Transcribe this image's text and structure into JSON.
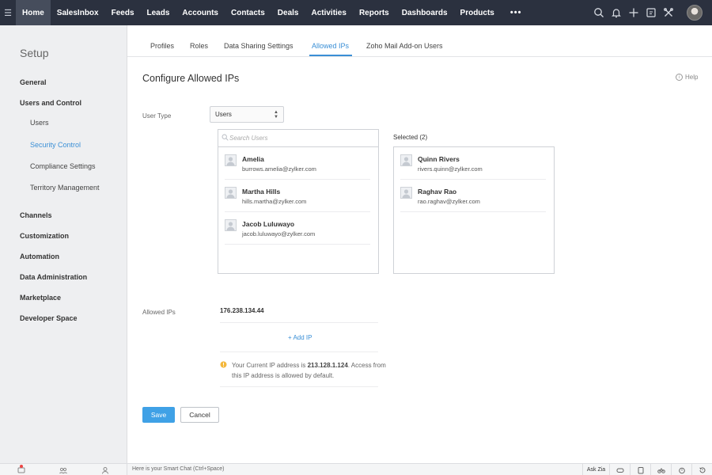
{
  "topnav": {
    "items": [
      "Home",
      "SalesInbox",
      "Feeds",
      "Leads",
      "Accounts",
      "Contacts",
      "Deals",
      "Activities",
      "Reports",
      "Dashboards",
      "Products"
    ],
    "more": "•••",
    "icons": [
      "search-icon",
      "bell-icon",
      "plus-icon",
      "calendar-icon",
      "tools-icon",
      "avatar"
    ]
  },
  "sidebar": {
    "title": "Setup",
    "sections": [
      "General",
      "Users and Control",
      "Channels",
      "Customization",
      "Automation",
      "Data Administration",
      "Marketplace",
      "Developer Space"
    ],
    "sub_items": [
      "Users",
      "Security Control",
      "Compliance Settings",
      "Territory Management"
    ],
    "active_sub": "Security Control"
  },
  "tabs": [
    "Profiles",
    "Roles",
    "Data Sharing Settings",
    "Allowed IPs",
    "Zoho Mail Add-on Users"
  ],
  "active_tab": "Allowed IPs",
  "page": {
    "title": "Configure Allowed IPs",
    "help": "Help"
  },
  "form": {
    "user_type_label": "User Type",
    "user_type_value": "Users",
    "search_placeholder": "Search Users",
    "selected_label": "Selected (2)",
    "available_users": [
      {
        "name": "Amelia",
        "email": "burrows.amelia@zylker.com"
      },
      {
        "name": "Martha Hills",
        "email": "hills.martha@zylker.com"
      },
      {
        "name": "Jacob Luluwayo",
        "email": "jacob.luluwayo@zylker.com"
      }
    ],
    "selected_users": [
      {
        "name": "Quinn Rivers",
        "email": "rivers.quinn@zylker.com"
      },
      {
        "name": "Raghav Rao",
        "email": "rao.raghav@zylker.com"
      }
    ],
    "allowed_ips_label": "Allowed IPs",
    "allowed_ip": "176.238.134.44",
    "add_ip": "+ Add IP",
    "info_prefix": "Your Current IP address is ",
    "current_ip": "213.128.1.124",
    "info_suffix": ". Access from this IP address is allowed by default.",
    "save": "Save",
    "cancel": "Cancel"
  },
  "bottombar": {
    "chat_placeholder": "Here is your Smart Chat (Ctrl+Space)",
    "ask_zia": "Ask Zia"
  },
  "colors": {
    "nav_bg": "#2b313f",
    "accent": "#3a8fd6",
    "save_button": "#3fa1e6",
    "sidebar_bg": "#eeeff1"
  }
}
